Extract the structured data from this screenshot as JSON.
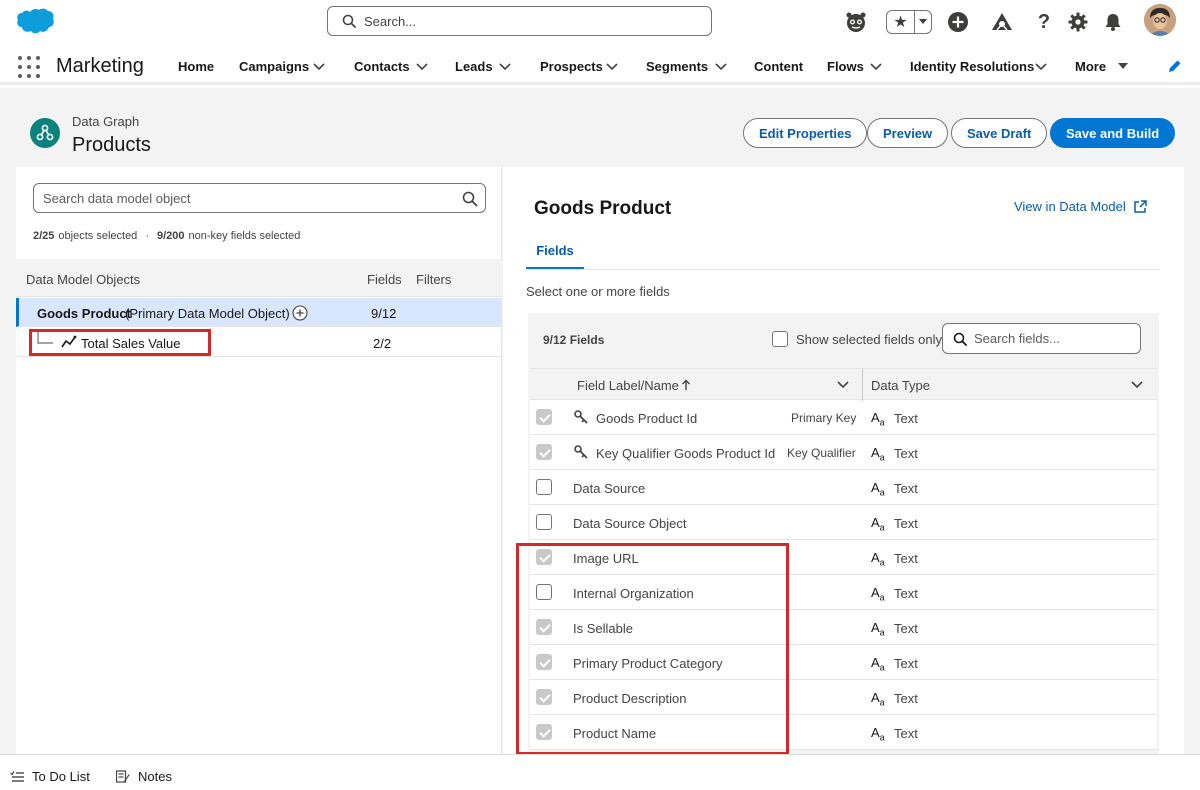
{
  "global_header": {
    "search_placeholder": "Search..."
  },
  "app_nav": {
    "app_name": "Marketing",
    "items": [
      {
        "label": "Home"
      },
      {
        "label": "Campaigns"
      },
      {
        "label": "Contacts"
      },
      {
        "label": "Leads"
      },
      {
        "label": "Prospects"
      },
      {
        "label": "Segments"
      },
      {
        "label": "Content"
      },
      {
        "label": "Flows"
      },
      {
        "label": "Identity Resolutions"
      },
      {
        "label": "More"
      }
    ]
  },
  "page_header": {
    "eyebrow": "Data Graph",
    "title": "Products",
    "buttons": {
      "edit_properties": "Edit Properties",
      "preview": "Preview",
      "save_draft": "Save Draft",
      "save_and_build": "Save and Build"
    }
  },
  "left_panel": {
    "search_placeholder": "Search data model object",
    "summary": {
      "objects": "2/25",
      "objects_label": "objects selected",
      "fields": "9/200",
      "fields_label": "non-key fields selected"
    },
    "columns": {
      "objects": "Data Model Objects",
      "fields": "Fields",
      "filters": "Filters"
    },
    "rows": [
      {
        "name": "Goods Product",
        "suffix": "(Primary Data Model Object)",
        "fields": "9/12"
      },
      {
        "name": "Total Sales Value",
        "fields": "2/2"
      }
    ]
  },
  "right_panel": {
    "title": "Goods Product",
    "view_link": "View in Data Model",
    "tab": "Fields",
    "hint": "Select one or more fields",
    "count": "9/12 Fields",
    "show_selected": "Show selected fields only",
    "field_search_placeholder": "Search fields...",
    "columns": {
      "label": "Field Label/Name",
      "type": "Data Type"
    },
    "type_icon": "Aa",
    "fields": [
      {
        "label": "Goods Product Id",
        "key": "Primary Key",
        "type": "Text",
        "checked": true,
        "disabled": true
      },
      {
        "label": "Key Qualifier Goods Product Id",
        "key": "Key Qualifier",
        "type": "Text",
        "checked": true,
        "disabled": true
      },
      {
        "label": "Data Source",
        "key": "",
        "type": "Text",
        "checked": false
      },
      {
        "label": "Data Source Object",
        "key": "",
        "type": "Text",
        "checked": false
      },
      {
        "label": "Image URL",
        "key": "",
        "type": "Text",
        "checked": true
      },
      {
        "label": "Internal Organization",
        "key": "",
        "type": "Text",
        "checked": false
      },
      {
        "label": "Is Sellable",
        "key": "",
        "type": "Text",
        "checked": true
      },
      {
        "label": "Primary Product Category",
        "key": "",
        "type": "Text",
        "checked": true
      },
      {
        "label": "Product Description",
        "key": "",
        "type": "Text",
        "checked": true
      },
      {
        "label": "Product Name",
        "key": "",
        "type": "Text",
        "checked": true
      }
    ]
  },
  "utility_bar": {
    "todo": "To Do List",
    "notes": "Notes"
  },
  "colors": {
    "brand": "#0176d3",
    "link": "#0b5cab",
    "highlight": "#d62828",
    "selected_row": "#d8e6fe"
  }
}
